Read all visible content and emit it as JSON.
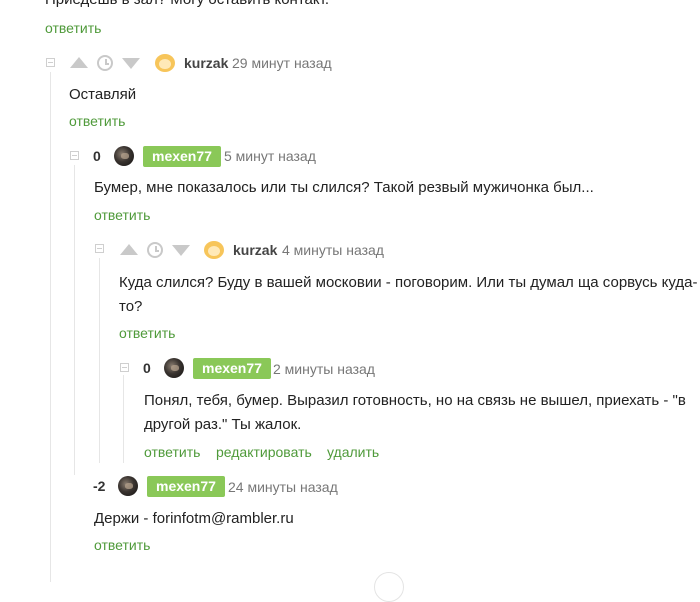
{
  "comments": {
    "c0": {
      "text": "Приедешь в зал? Могу оставить контакт.",
      "reply": "ответить"
    },
    "c1": {
      "user": "kurzak",
      "time": "29 минут назад",
      "text": "Оставляй",
      "reply": "ответить"
    },
    "c2": {
      "score": "0",
      "user": "mexen77",
      "time": "5 минут назад",
      "text": "Бумер, мне показалось или ты слился? Такой резвый мужичонка был...",
      "reply": "ответить"
    },
    "c3": {
      "user": "kurzak",
      "time": "4 минуты назад",
      "text_line1": "Куда слился? Буду в вашей московии - поговорим. Или ты думал ща сорвусь куда-",
      "text_line2": "то?",
      "reply": "ответить"
    },
    "c4": {
      "score": "0",
      "user": "mexen77",
      "time": "2 минуты назад",
      "text_line1": "Понял, тебя, бумер. Выразил готовность, но на связь не вышел, приехать - \"в",
      "text_line2": "другой раз.\" Ты жалок.",
      "reply": "ответить",
      "edit": "редактировать",
      "delete": "удалить"
    },
    "c5": {
      "score": "-2",
      "user": "mexen77",
      "time": "24 минуты назад",
      "text": "Держи - forinfotm@rambler.ru",
      "reply": "ответить"
    }
  },
  "colors": {
    "accent": "#4f9a3a",
    "badge": "#8ac858",
    "icon": "#c9c9c9"
  }
}
